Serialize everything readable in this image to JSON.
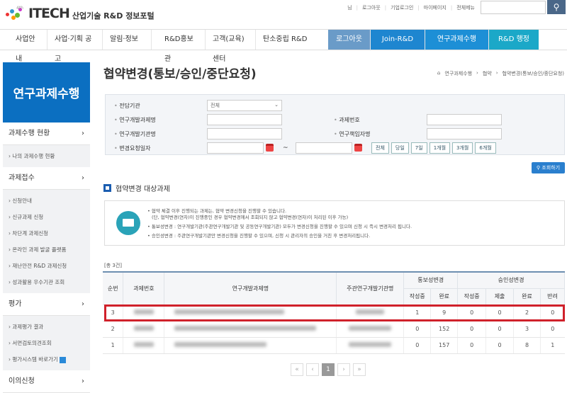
{
  "header": {
    "brand": "ITECH",
    "subtitle": "산업기술 R&D 정보포털",
    "util_links": [
      "님",
      "로그아웃",
      "기업로그인",
      "마이페이지",
      "전체메뉴"
    ],
    "search_icon": "search-icon"
  },
  "gnb": {
    "items": [
      "사업안내",
      "사업·기획 공고",
      "알림·정보",
      "R&D홍보관",
      "고객(교육)센터",
      "탄소중립 R&D"
    ],
    "right": [
      "로그아웃",
      "Join-R&D",
      "연구과제수행",
      "R&D 행정지원"
    ]
  },
  "sidebar": {
    "title": "연구과제수행",
    "groups": [
      {
        "label": "과제수행 현황",
        "subs": [
          "나의 과제수행 현황"
        ]
      },
      {
        "label": "과제접수",
        "subs": [
          "신청안내",
          "신규과제 신청",
          "차단계 과제신청",
          "온라인 과제 발굴 플랫폼",
          "재난안전 R&D 과제신청",
          "성과활용 우수기관 조회"
        ]
      },
      {
        "label": "평가",
        "subs": [
          "과제평가 결과",
          "서면검토의견조회",
          "평가시스템 바로가기"
        ]
      },
      {
        "label": "이의신청",
        "subs": []
      }
    ]
  },
  "page": {
    "title": "협약변경(통보/승인/중단요청)",
    "breadcrumb": [
      "연구과제수행",
      "협약",
      "협약변경(통보/승인/중단요청)"
    ]
  },
  "search": {
    "agency_label": "전담기관",
    "agency_value": "전체",
    "title_label": "연구개발과제명",
    "number_label": "과제번호",
    "org_label": "연구개발기관명",
    "pi_label": "연구책임자명",
    "date_label": "변경요청일자",
    "date_sep": "~",
    "periods": [
      "전체",
      "당일",
      "7일",
      "1개월",
      "3개월",
      "6개월"
    ],
    "query_button": "조회하기"
  },
  "section": {
    "title": "협약변경 대상과제"
  },
  "notice": {
    "lines": [
      "• 협약 체결 이후 진행되는 과제는, 협약 변경신청을 진행할 수 있습니다.",
      "(단, 협약변경(연차)이 진행중인 경우 협약변경에서 조회되지 않고 협약변경(연차)이 처리된 이후 가능)",
      "• 통보성변경 : 연구개발기관(주관연구개발기관 및 공동연구개발기관) 모두가 변경신청을 진행할 수 있으며 신청 시 즉시 변경처리 됩니다.",
      "• 승인성변경 : 주관연구개발기관만 변경신청을 진행할 수 있으며, 신청 시 관리자의 승인을 거친 후 변경처리됩니다."
    ]
  },
  "table": {
    "total": "[총 3건]",
    "headers": {
      "no": "순번",
      "number": "과제번호",
      "title": "연구개발과제명",
      "org": "주관연구개발기관명",
      "notify": "통보성변경",
      "approve": "승인성변경",
      "n_writing": "작성중",
      "n_done": "완료",
      "a_writing": "작성중",
      "a_submit": "제출",
      "a_done": "완료",
      "a_reject": "반려"
    },
    "rows": [
      {
        "no": "3",
        "n_writing": "1",
        "n_done": "9",
        "a_writing": "0",
        "a_submit": "0",
        "a_done": "2",
        "a_reject": "0"
      },
      {
        "no": "2",
        "n_writing": "0",
        "n_done": "152",
        "a_writing": "0",
        "a_submit": "0",
        "a_done": "3",
        "a_reject": "0"
      },
      {
        "no": "1",
        "n_writing": "0",
        "n_done": "157",
        "a_writing": "0",
        "a_submit": "0",
        "a_done": "8",
        "a_reject": "1"
      }
    ]
  },
  "pager": {
    "first": "«",
    "prev": "‹",
    "current": "1",
    "next": "›",
    "last": "»"
  }
}
